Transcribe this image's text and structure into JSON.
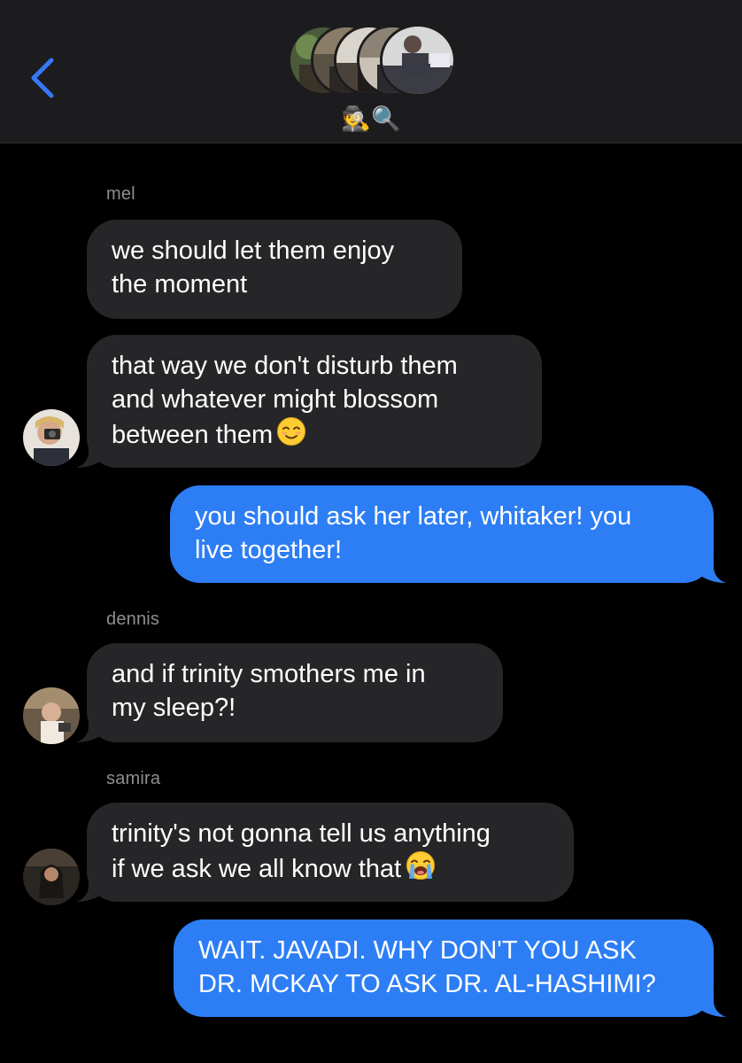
{
  "header": {
    "group_name": "🕵🔍",
    "back_icon": "chevron-left-icon",
    "accent_color": "#3478f6"
  },
  "messages": [
    {
      "sender": "mel",
      "direction": "incoming",
      "text": "we should let them enjoy\nthe moment"
    },
    {
      "sender": "mel",
      "direction": "incoming",
      "text": "that way we don't disturb them\nand whatever might blossom\nbetween them",
      "emoji": "relieved-face"
    },
    {
      "sender": "me",
      "direction": "outgoing",
      "text": "you should ask her later, whitaker! you\nlive together!"
    },
    {
      "sender": "dennis",
      "direction": "incoming",
      "text": "and if trinity smothers me in\nmy sleep?!"
    },
    {
      "sender": "samira",
      "direction": "incoming",
      "text": "trinity's not gonna tell us anything\nif we ask we all know that",
      "emoji": "loudly-crying-face"
    },
    {
      "sender": "me",
      "direction": "outgoing",
      "text": "WAIT. JAVADI. WHY DON'T YOU ASK\nDR. MCKAY TO ASK DR. AL-HASHIMI?"
    }
  ],
  "sender_labels": {
    "mel": "mel",
    "dennis": "dennis",
    "samira": "samira"
  },
  "colors": {
    "incoming_bubble": "#262629",
    "outgoing_bubble": "#2d7ef5",
    "sender_label": "#8e8e93",
    "header_bg": "#1c1c1e"
  }
}
